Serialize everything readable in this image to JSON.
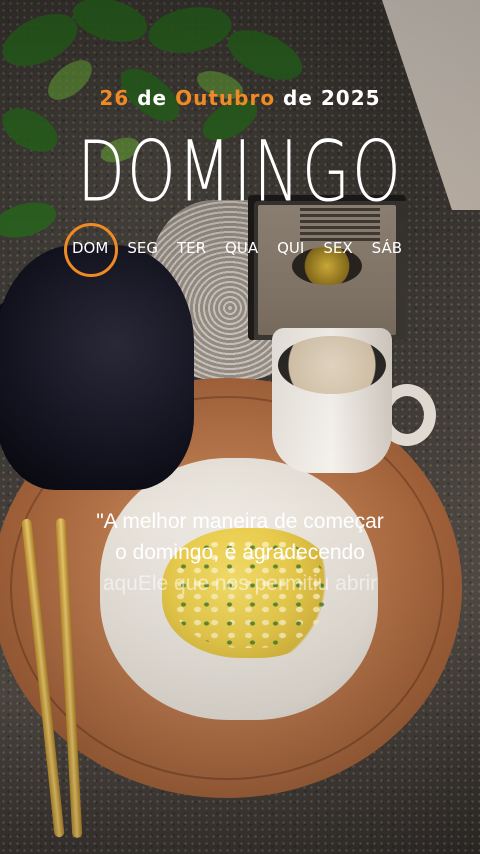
{
  "date": {
    "day": "26",
    "connector1": "de",
    "month": "Outubro",
    "connector2": "de",
    "year": "2025",
    "accent_color": "#f08a24"
  },
  "weekday_title": "DOMINGO",
  "week_days": [
    "DOM",
    "SEG",
    "TER",
    "QUA",
    "QUI",
    "SEX",
    "SÁB"
  ],
  "active_day": "DOM",
  "quote": {
    "line1": "\"A melhor maneira de começar",
    "line2": "o domingo, é agradecendo",
    "line3": "aquEle que nos permitiu abrir"
  }
}
